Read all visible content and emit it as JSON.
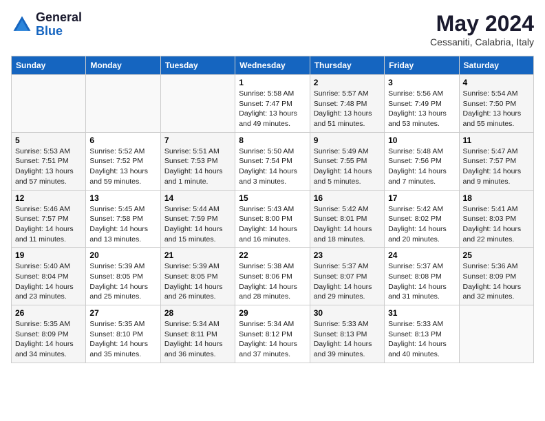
{
  "header": {
    "logo_general": "General",
    "logo_blue": "Blue",
    "month_year": "May 2024",
    "location": "Cessaniti, Calabria, Italy"
  },
  "weekdays": [
    "Sunday",
    "Monday",
    "Tuesday",
    "Wednesday",
    "Thursday",
    "Friday",
    "Saturday"
  ],
  "weeks": [
    [
      {
        "day": "",
        "sunrise": "",
        "sunset": "",
        "daylight": ""
      },
      {
        "day": "",
        "sunrise": "",
        "sunset": "",
        "daylight": ""
      },
      {
        "day": "",
        "sunrise": "",
        "sunset": "",
        "daylight": ""
      },
      {
        "day": "1",
        "sunrise": "Sunrise: 5:58 AM",
        "sunset": "Sunset: 7:47 PM",
        "daylight": "Daylight: 13 hours and 49 minutes."
      },
      {
        "day": "2",
        "sunrise": "Sunrise: 5:57 AM",
        "sunset": "Sunset: 7:48 PM",
        "daylight": "Daylight: 13 hours and 51 minutes."
      },
      {
        "day": "3",
        "sunrise": "Sunrise: 5:56 AM",
        "sunset": "Sunset: 7:49 PM",
        "daylight": "Daylight: 13 hours and 53 minutes."
      },
      {
        "day": "4",
        "sunrise": "Sunrise: 5:54 AM",
        "sunset": "Sunset: 7:50 PM",
        "daylight": "Daylight: 13 hours and 55 minutes."
      }
    ],
    [
      {
        "day": "5",
        "sunrise": "Sunrise: 5:53 AM",
        "sunset": "Sunset: 7:51 PM",
        "daylight": "Daylight: 13 hours and 57 minutes."
      },
      {
        "day": "6",
        "sunrise": "Sunrise: 5:52 AM",
        "sunset": "Sunset: 7:52 PM",
        "daylight": "Daylight: 13 hours and 59 minutes."
      },
      {
        "day": "7",
        "sunrise": "Sunrise: 5:51 AM",
        "sunset": "Sunset: 7:53 PM",
        "daylight": "Daylight: 14 hours and 1 minute."
      },
      {
        "day": "8",
        "sunrise": "Sunrise: 5:50 AM",
        "sunset": "Sunset: 7:54 PM",
        "daylight": "Daylight: 14 hours and 3 minutes."
      },
      {
        "day": "9",
        "sunrise": "Sunrise: 5:49 AM",
        "sunset": "Sunset: 7:55 PM",
        "daylight": "Daylight: 14 hours and 5 minutes."
      },
      {
        "day": "10",
        "sunrise": "Sunrise: 5:48 AM",
        "sunset": "Sunset: 7:56 PM",
        "daylight": "Daylight: 14 hours and 7 minutes."
      },
      {
        "day": "11",
        "sunrise": "Sunrise: 5:47 AM",
        "sunset": "Sunset: 7:57 PM",
        "daylight": "Daylight: 14 hours and 9 minutes."
      }
    ],
    [
      {
        "day": "12",
        "sunrise": "Sunrise: 5:46 AM",
        "sunset": "Sunset: 7:57 PM",
        "daylight": "Daylight: 14 hours and 11 minutes."
      },
      {
        "day": "13",
        "sunrise": "Sunrise: 5:45 AM",
        "sunset": "Sunset: 7:58 PM",
        "daylight": "Daylight: 14 hours and 13 minutes."
      },
      {
        "day": "14",
        "sunrise": "Sunrise: 5:44 AM",
        "sunset": "Sunset: 7:59 PM",
        "daylight": "Daylight: 14 hours and 15 minutes."
      },
      {
        "day": "15",
        "sunrise": "Sunrise: 5:43 AM",
        "sunset": "Sunset: 8:00 PM",
        "daylight": "Daylight: 14 hours and 16 minutes."
      },
      {
        "day": "16",
        "sunrise": "Sunrise: 5:42 AM",
        "sunset": "Sunset: 8:01 PM",
        "daylight": "Daylight: 14 hours and 18 minutes."
      },
      {
        "day": "17",
        "sunrise": "Sunrise: 5:42 AM",
        "sunset": "Sunset: 8:02 PM",
        "daylight": "Daylight: 14 hours and 20 minutes."
      },
      {
        "day": "18",
        "sunrise": "Sunrise: 5:41 AM",
        "sunset": "Sunset: 8:03 PM",
        "daylight": "Daylight: 14 hours and 22 minutes."
      }
    ],
    [
      {
        "day": "19",
        "sunrise": "Sunrise: 5:40 AM",
        "sunset": "Sunset: 8:04 PM",
        "daylight": "Daylight: 14 hours and 23 minutes."
      },
      {
        "day": "20",
        "sunrise": "Sunrise: 5:39 AM",
        "sunset": "Sunset: 8:05 PM",
        "daylight": "Daylight: 14 hours and 25 minutes."
      },
      {
        "day": "21",
        "sunrise": "Sunrise: 5:39 AM",
        "sunset": "Sunset: 8:05 PM",
        "daylight": "Daylight: 14 hours and 26 minutes."
      },
      {
        "day": "22",
        "sunrise": "Sunrise: 5:38 AM",
        "sunset": "Sunset: 8:06 PM",
        "daylight": "Daylight: 14 hours and 28 minutes."
      },
      {
        "day": "23",
        "sunrise": "Sunrise: 5:37 AM",
        "sunset": "Sunset: 8:07 PM",
        "daylight": "Daylight: 14 hours and 29 minutes."
      },
      {
        "day": "24",
        "sunrise": "Sunrise: 5:37 AM",
        "sunset": "Sunset: 8:08 PM",
        "daylight": "Daylight: 14 hours and 31 minutes."
      },
      {
        "day": "25",
        "sunrise": "Sunrise: 5:36 AM",
        "sunset": "Sunset: 8:09 PM",
        "daylight": "Daylight: 14 hours and 32 minutes."
      }
    ],
    [
      {
        "day": "26",
        "sunrise": "Sunrise: 5:35 AM",
        "sunset": "Sunset: 8:09 PM",
        "daylight": "Daylight: 14 hours and 34 minutes."
      },
      {
        "day": "27",
        "sunrise": "Sunrise: 5:35 AM",
        "sunset": "Sunset: 8:10 PM",
        "daylight": "Daylight: 14 hours and 35 minutes."
      },
      {
        "day": "28",
        "sunrise": "Sunrise: 5:34 AM",
        "sunset": "Sunset: 8:11 PM",
        "daylight": "Daylight: 14 hours and 36 minutes."
      },
      {
        "day": "29",
        "sunrise": "Sunrise: 5:34 AM",
        "sunset": "Sunset: 8:12 PM",
        "daylight": "Daylight: 14 hours and 37 minutes."
      },
      {
        "day": "30",
        "sunrise": "Sunrise: 5:33 AM",
        "sunset": "Sunset: 8:13 PM",
        "daylight": "Daylight: 14 hours and 39 minutes."
      },
      {
        "day": "31",
        "sunrise": "Sunrise: 5:33 AM",
        "sunset": "Sunset: 8:13 PM",
        "daylight": "Daylight: 14 hours and 40 minutes."
      },
      {
        "day": "",
        "sunrise": "",
        "sunset": "",
        "daylight": ""
      }
    ]
  ]
}
